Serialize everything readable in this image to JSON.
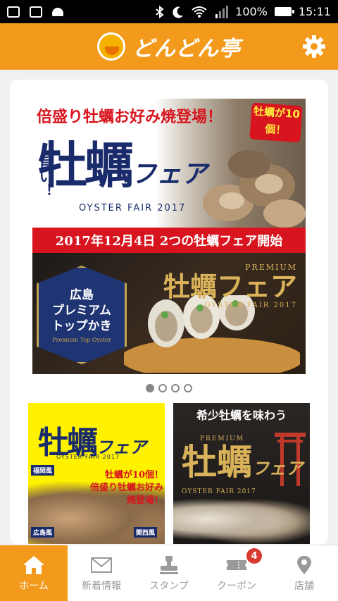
{
  "status_bar": {
    "battery": "100%",
    "time": "15:11"
  },
  "header": {
    "logo_text": "どんどん亭"
  },
  "banner": {
    "headline": "倍盛り牡蠣お好み焼登場！",
    "sticker": "牡蠣が10個！",
    "umai": "旨い！",
    "title": "牡蠣",
    "title_suffix": "フェア",
    "subtitle": "OYSTER FAIR 2017",
    "date_line": "2017年12月4日 2つの牡蠣フェア開始",
    "badge_line1": "広島",
    "badge_line2": "プレミアム",
    "badge_line3": "トップかき",
    "badge_sub": "Premium Top Oyster",
    "premium_label": "PREMIUM",
    "premium_title": "牡蠣フェア",
    "premium_sub": "OYSTER FAIR 2017"
  },
  "carousel": {
    "pages": 4,
    "active_index": 0
  },
  "thumbnails": [
    {
      "title": "牡蠣",
      "title_suffix": "フェア",
      "subtitle": "OYSTER FAIR 2017",
      "sticker": "牡蠣が10個！",
      "copy": "倍盛り牡蠣お好み焼登場！",
      "tag_left_top": "福岡風",
      "tag_left_bottom": "広島風",
      "tag_right": "関西風"
    },
    {
      "head": "希少牡蠣を味わう",
      "premium_label": "PREMIUM",
      "title": "牡蠣",
      "title_suffix": "フェア",
      "subtitle": "OYSTER FAIR 2017"
    }
  ],
  "nav": {
    "items": [
      {
        "label": "ホーム",
        "icon": "home-icon"
      },
      {
        "label": "新着情報",
        "icon": "mail-icon"
      },
      {
        "label": "スタンプ",
        "icon": "stamp-icon"
      },
      {
        "label": "クーポン",
        "icon": "coupon-icon",
        "badge": "4"
      },
      {
        "label": "店舗",
        "icon": "location-pin-icon"
      }
    ]
  },
  "colors": {
    "brand_orange": "#f39a1c",
    "badge_red": "#d73a2e",
    "headline_red": "#d8141e",
    "navy": "#1a2b6c",
    "gold": "#d9b25a"
  }
}
